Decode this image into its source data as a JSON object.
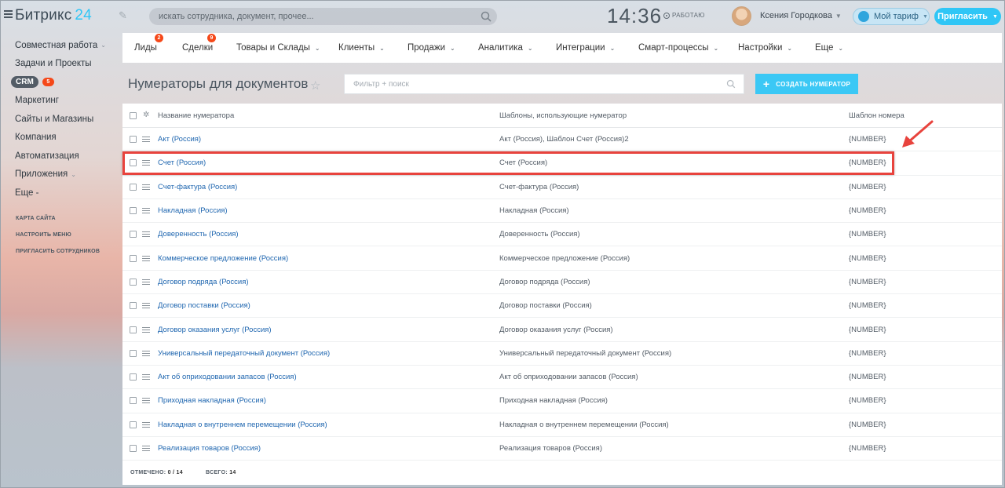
{
  "header": {
    "logo_text": "Битрикс",
    "logo_num": "24",
    "search_placeholder": "искать сотрудника, документ, прочее...",
    "clock": "14:36",
    "work_status": "РАБОТАЮ",
    "user_name": "Ксения Городкова",
    "tariff_label": "Мой тариф",
    "invite_label": "Пригласить"
  },
  "sidebar": {
    "items": [
      {
        "label": "Совместная работа",
        "chev": true
      },
      {
        "label": "Задачи и Проекты"
      },
      {
        "label": "CRM",
        "badge": "5"
      },
      {
        "label": "Маркетинг"
      },
      {
        "label": "Сайты и Магазины"
      },
      {
        "label": "Компания"
      },
      {
        "label": "Автоматизация"
      },
      {
        "label": "Приложения",
        "chev": true
      },
      {
        "label": "Еще -"
      }
    ],
    "links": [
      "КАРТА САЙТА",
      "НАСТРОИТЬ МЕНЮ",
      "ПРИГЛАСИТЬ СОТРУДНИКОВ"
    ]
  },
  "nav": {
    "items": [
      {
        "label": "Лиды",
        "badge": "2"
      },
      {
        "label": "Сделки",
        "badge": "9"
      },
      {
        "label": "Товары и Склады",
        "chev": true
      },
      {
        "label": "Клиенты",
        "chev": true
      },
      {
        "label": "Продажи",
        "chev": true
      },
      {
        "label": "Аналитика",
        "chev": true
      },
      {
        "label": "Интеграции",
        "chev": true
      },
      {
        "label": "Смарт-процессы",
        "chev": true
      },
      {
        "label": "Настройки",
        "chev": true
      },
      {
        "label": "Еще",
        "chev": true
      }
    ]
  },
  "page": {
    "title": "Нумераторы для документов",
    "filter_placeholder": "Фильтр + поиск",
    "create_button": "СОЗДАТЬ НУМЕРАТОР"
  },
  "grid": {
    "columns": [
      "Название нумератора",
      "Шаблоны, использующие нумератор",
      "Шаблон номера"
    ],
    "rows": [
      [
        "Акт (Россия)",
        "Акт (Россия), Шаблон Счет (Россия)2",
        "{NUMBER}"
      ],
      [
        "Счет (Россия)",
        "Счет (Россия)",
        "{NUMBER}"
      ],
      [
        "Счет-фактура (Россия)",
        "Счет-фактура (Россия)",
        "{NUMBER}"
      ],
      [
        "Накладная (Россия)",
        "Накладная (Россия)",
        "{NUMBER}"
      ],
      [
        "Доверенность (Россия)",
        "Доверенность (Россия)",
        "{NUMBER}"
      ],
      [
        "Коммерческое предложение (Россия)",
        "Коммерческое предложение (Россия)",
        "{NUMBER}"
      ],
      [
        "Договор подряда (Россия)",
        "Договор подряда (Россия)",
        "{NUMBER}"
      ],
      [
        "Договор поставки (Россия)",
        "Договор поставки (Россия)",
        "{NUMBER}"
      ],
      [
        "Договор оказания услуг (Россия)",
        "Договор оказания услуг (Россия)",
        "{NUMBER}"
      ],
      [
        "Универсальный передаточный документ (Россия)",
        "Универсальный передаточный документ (Россия)",
        "{NUMBER}"
      ],
      [
        "Акт об оприходовании запасов (Россия)",
        "Акт об оприходовании запасов (Россия)",
        "{NUMBER}"
      ],
      [
        "Приходная накладная (Россия)",
        "Приходная накладная (Россия)",
        "{NUMBER}"
      ],
      [
        "Накладная о внутреннем перемещении (Россия)",
        "Накладная о внутреннем перемещении (Россия)",
        "{NUMBER}"
      ],
      [
        "Реализация товаров (Россия)",
        "Реализация товаров (Россия)",
        "{NUMBER}"
      ]
    ],
    "footer": {
      "selected_label": "ОТМЕЧЕНО:",
      "selected_value": "0 / 14",
      "total_label": "ВСЕГО:",
      "total_value": "14"
    }
  },
  "colors": {
    "accent": "#2fc6f6",
    "link": "#2067b0",
    "badge": "#f54819",
    "annotation": "#e8433d"
  }
}
